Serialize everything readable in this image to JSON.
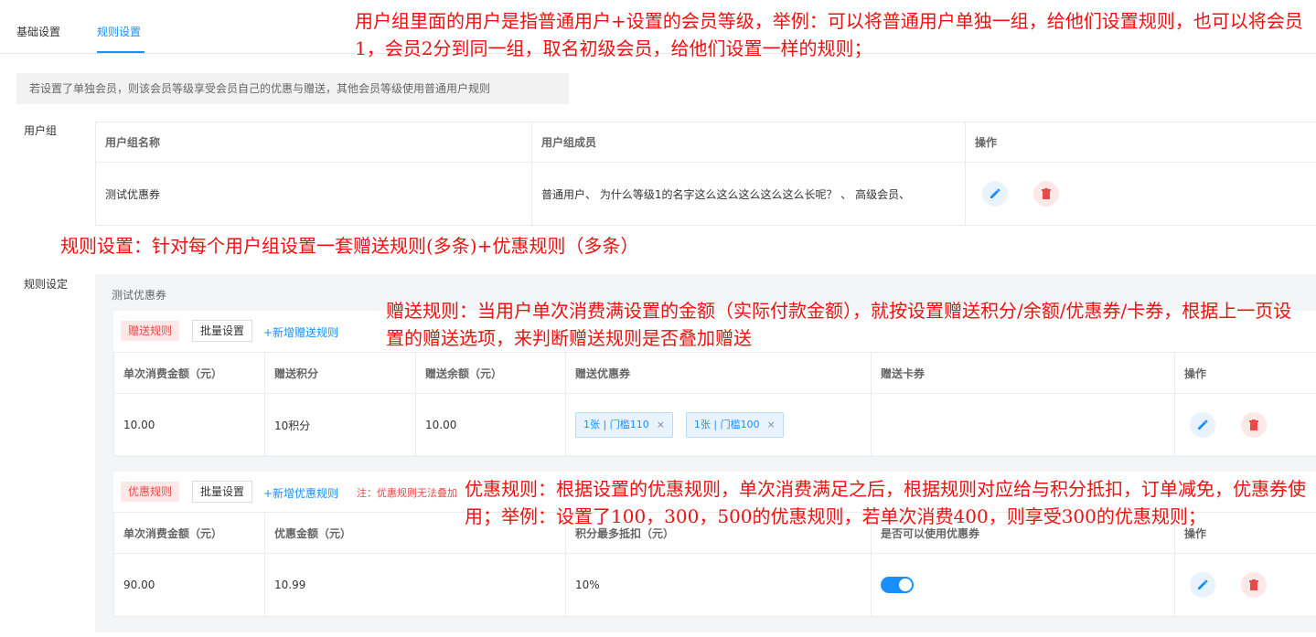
{
  "tabs": [
    "基础设置",
    "规则设置"
  ],
  "notice": "若设置了单独会员，则该会员等级享受会员自己的优惠与赠送，其他会员等级使用普通用户规则",
  "user_group": {
    "label": "用户组",
    "headers": [
      "用户组名称",
      "用户组成员",
      "操作"
    ],
    "rows": [
      {
        "name": "测试优惠券",
        "members": "普通用户、 为什么等级1的名字这么这么这么这么这么长呢？ 、 高级会员、"
      }
    ]
  },
  "rules": {
    "label": "规则设定",
    "group_name": "测试优惠券",
    "gift": {
      "tag": "赠送规则",
      "batch": "批量设置",
      "add": "+新增赠送规则",
      "headers": [
        "单次消费金额（元）",
        "赠送积分",
        "赠送余额（元）",
        "赠送优惠券",
        "赠送卡券",
        "操作"
      ],
      "row": {
        "amount": "10.00",
        "points": "10积分",
        "balance": "10.00",
        "coupons": [
          "1张 | 门槛110",
          "1张 | 门槛100"
        ],
        "cards": ""
      }
    },
    "discount": {
      "tag": "优惠规则",
      "batch": "批量设置",
      "add": "+新增优惠规则",
      "note": "注：优惠规则无法叠加",
      "headers": [
        "单次消费金额（元）",
        "优惠金额（元）",
        "积分最多抵扣（元）",
        "是否可以使用优惠券",
        "操作"
      ],
      "row": {
        "amount": "90.00",
        "discount": "10.99",
        "points_max": "10%",
        "can_use_coupon": true
      }
    }
  },
  "annotations": {
    "top": "用户组里面的用户是指普通用户+设置的会员等级，举例：可以将普通用户单独一组，给他们设置规则，也可以将会员1，会员2分到同一组，取名初级会员，给他们设置一样的规则；",
    "rules": "规则设置：针对每个用户组设置一套赠送规则(多条)+优惠规则（多条）",
    "gift": "赠送规则：当用户单次消费满设置的金额（实际付款金额），就按设置赠送积分/余额/优惠券/卡券，根据上一页设置的赠送选项，来判断赠送规则是否叠加赠送",
    "discount": "优惠规则：根据设置的优惠规则，单次消费满足之后，根据规则对应给与积分抵扣，订单减免，优惠券使用；举例：设置了100，300，500的优惠规则，若单次消费400，则享受300的优惠规则；"
  },
  "colors": {
    "accent": "#1890ff",
    "danger": "#e84a4a",
    "annotation": "#ee1111"
  }
}
